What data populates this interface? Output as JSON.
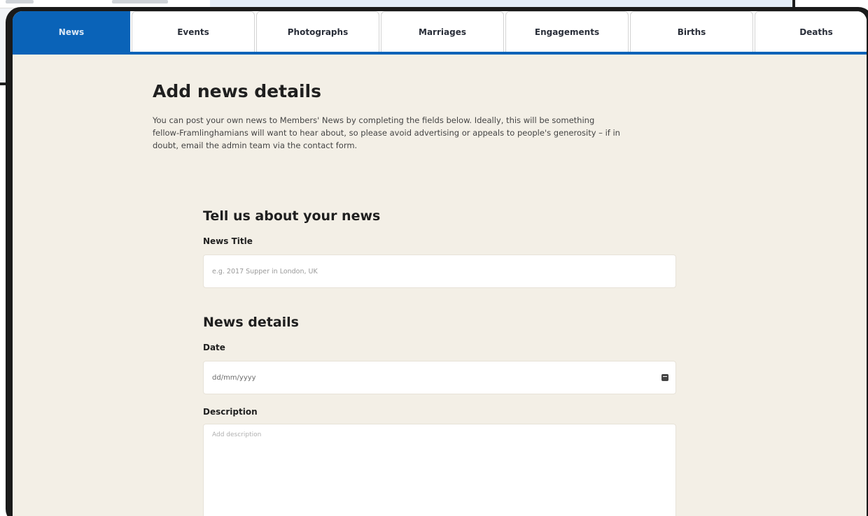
{
  "tabs": [
    {
      "label": "News",
      "active": true
    },
    {
      "label": "Events"
    },
    {
      "label": "Photographs"
    },
    {
      "label": "Marriages"
    },
    {
      "label": "Engagements"
    },
    {
      "label": "Births"
    },
    {
      "label": "Deaths"
    }
  ],
  "page": {
    "title": "Add news details",
    "intro": "You can post your own news to Members' News by completing the fields below. Ideally, this will be something fellow-Framlinghamians will want to hear about, so please avoid advertising or appeals to people's generosity – if in doubt, email the admin team via the contact form."
  },
  "form": {
    "section_news": "Tell us about your news",
    "news_title_label": "News Title",
    "news_title_placeholder": "e.g. 2017 Supper in London, UK",
    "section_details": "News details",
    "date_label": "Date",
    "date_placeholder": "dd/mm/yyyy",
    "description_label": "Description",
    "description_placeholder": "Add description"
  },
  "colors": {
    "accent": "#0a63b8",
    "page_bg": "#f3efe6",
    "frame": "#1a1a1a"
  },
  "icons": {
    "date_picker": "calendar-icon"
  }
}
